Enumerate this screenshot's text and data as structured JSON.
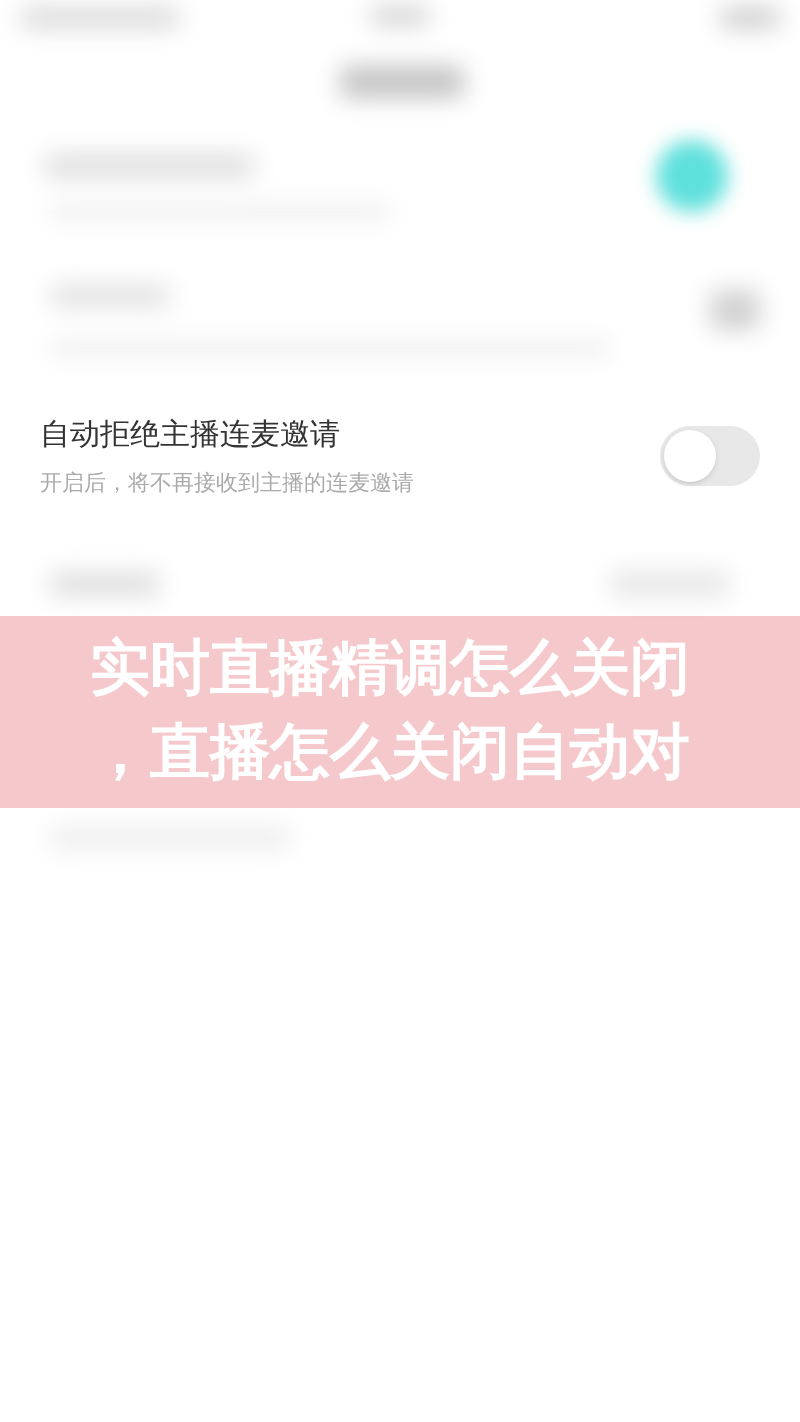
{
  "setting": {
    "title": "自动拒绝主播连麦邀请",
    "description": "开启后，将不再接收到主播的连麦邀请",
    "on": false
  },
  "banner": {
    "lines": [
      "实时直播精调怎么关闭",
      "，直播怎么关闭自动对"
    ]
  }
}
